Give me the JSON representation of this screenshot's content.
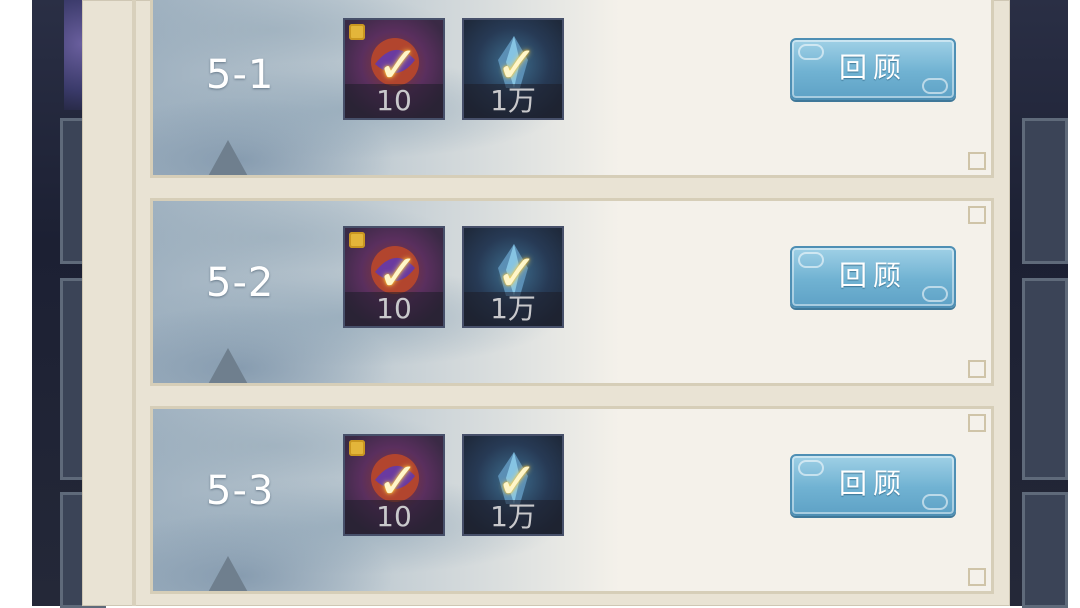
{
  "rows": [
    {
      "stage": "5-1",
      "items": [
        {
          "qty": "10"
        },
        {
          "qty": "1万"
        }
      ],
      "button": "回顾"
    },
    {
      "stage": "5-2",
      "items": [
        {
          "qty": "10"
        },
        {
          "qty": "1万"
        }
      ],
      "button": "回顾"
    },
    {
      "stage": "5-3",
      "items": [
        {
          "qty": "10"
        },
        {
          "qty": "1万"
        }
      ],
      "button": "回顾"
    }
  ],
  "icons": {
    "reward_1": "fragment-scroll-icon",
    "reward_2": "crystal-icon",
    "claimed": "checkmark-icon",
    "piece": "puzzle-piece-icon"
  },
  "colors": {
    "button": "#70b2d2",
    "panel": "#e9e3d4",
    "check": "#fff6c9"
  }
}
